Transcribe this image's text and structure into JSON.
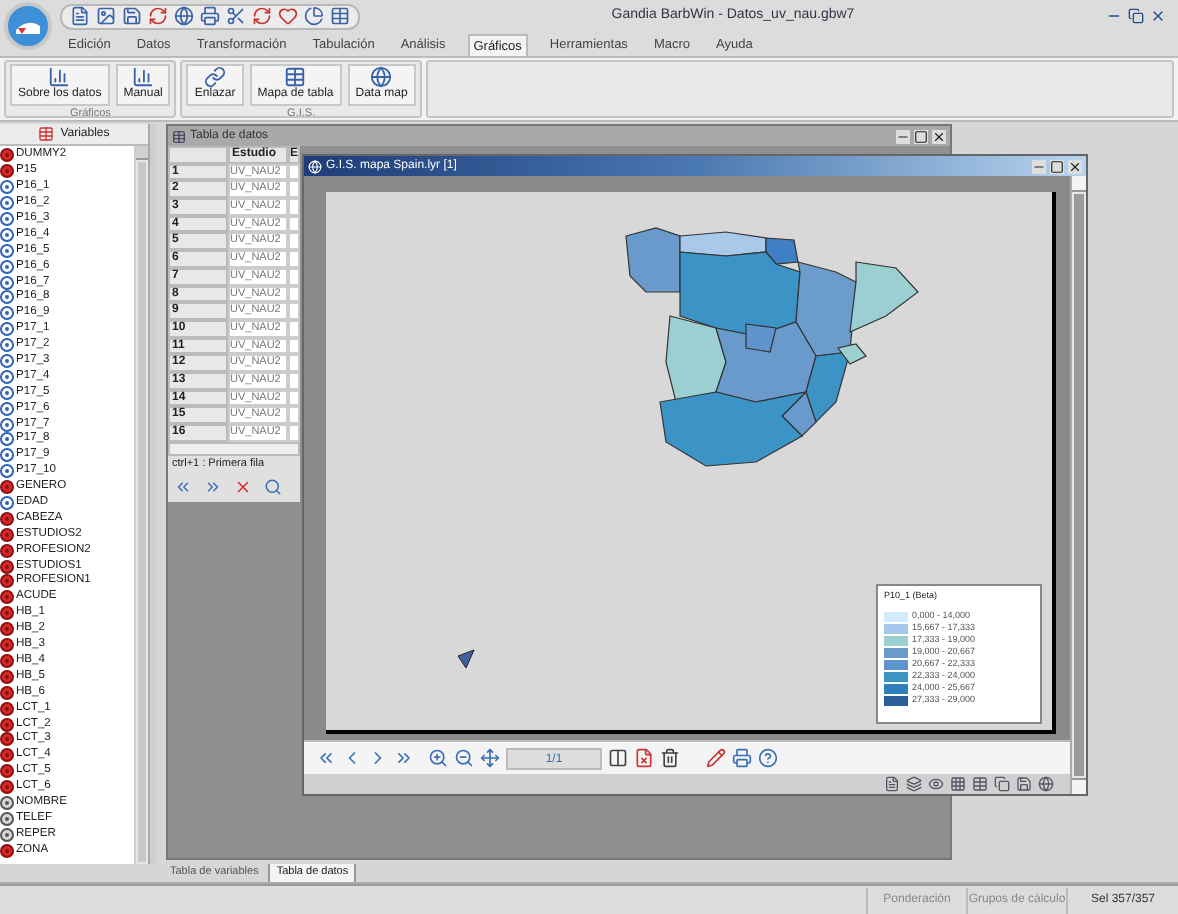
{
  "window": {
    "title": "Gandia BarbWin - Datos_uv_nau.gbw7"
  },
  "menu": [
    {
      "label": "Edición",
      "selected": false
    },
    {
      "label": "Datos",
      "selected": false
    },
    {
      "label": "Transformación",
      "selected": false
    },
    {
      "label": "Tabulación",
      "selected": false
    },
    {
      "label": "Análisis",
      "selected": false
    },
    {
      "label": "Gráficos",
      "selected": true
    },
    {
      "label": "Herramientas",
      "selected": false
    },
    {
      "label": "Macro",
      "selected": false
    },
    {
      "label": "Ayuda",
      "selected": false
    }
  ],
  "ribbon": {
    "groups": [
      {
        "label": "Gráficos",
        "buttons": [
          {
            "label": "Sobre los datos",
            "kind": "chart"
          },
          {
            "label": "Manual",
            "kind": "chart"
          }
        ]
      },
      {
        "label": "G.I.S.",
        "buttons": [
          {
            "label": "Enlazar",
            "kind": "link"
          },
          {
            "label": "Mapa de tabla",
            "kind": "table"
          },
          {
            "label": "Data map",
            "kind": "globe"
          }
        ]
      }
    ]
  },
  "variables_panel": {
    "title": "Variables",
    "items": [
      {
        "name": "DUMMY2",
        "kind": "nominal"
      },
      {
        "name": "P15",
        "kind": "nominal"
      },
      {
        "name": "P16_1",
        "kind": "scale"
      },
      {
        "name": "P16_2",
        "kind": "scale"
      },
      {
        "name": "P16_3",
        "kind": "scale"
      },
      {
        "name": "P16_4",
        "kind": "scale"
      },
      {
        "name": "P16_5",
        "kind": "scale"
      },
      {
        "name": "P16_6",
        "kind": "scale"
      },
      {
        "name": "P16_7",
        "kind": "scale"
      },
      {
        "name": "P16_8",
        "kind": "scale"
      },
      {
        "name": "P16_9",
        "kind": "scale"
      },
      {
        "name": "P17_1",
        "kind": "scale"
      },
      {
        "name": "P17_2",
        "kind": "scale"
      },
      {
        "name": "P17_3",
        "kind": "scale"
      },
      {
        "name": "P17_4",
        "kind": "scale"
      },
      {
        "name": "P17_5",
        "kind": "scale"
      },
      {
        "name": "P17_6",
        "kind": "scale"
      },
      {
        "name": "P17_7",
        "kind": "scale"
      },
      {
        "name": "P17_8",
        "kind": "scale"
      },
      {
        "name": "P17_9",
        "kind": "scale"
      },
      {
        "name": "P17_10",
        "kind": "scale"
      },
      {
        "name": "GENERO",
        "kind": "nominal"
      },
      {
        "name": "EDAD",
        "kind": "scale"
      },
      {
        "name": "CABEZA",
        "kind": "nominal"
      },
      {
        "name": "ESTUDIOS2",
        "kind": "nominal"
      },
      {
        "name": "PROFESION2",
        "kind": "nominal"
      },
      {
        "name": "ESTUDIOS1",
        "kind": "nominal"
      },
      {
        "name": "PROFESION1",
        "kind": "nominal"
      },
      {
        "name": "ACUDE",
        "kind": "nominal"
      },
      {
        "name": "HB_1",
        "kind": "nominal"
      },
      {
        "name": "HB_2",
        "kind": "nominal"
      },
      {
        "name": "HB_3",
        "kind": "nominal"
      },
      {
        "name": "HB_4",
        "kind": "nominal"
      },
      {
        "name": "HB_5",
        "kind": "nominal"
      },
      {
        "name": "HB_6",
        "kind": "nominal"
      },
      {
        "name": "LCT_1",
        "kind": "nominal"
      },
      {
        "name": "LCT_2",
        "kind": "nominal"
      },
      {
        "name": "LCT_3",
        "kind": "nominal"
      },
      {
        "name": "LCT_4",
        "kind": "nominal"
      },
      {
        "name": "LCT_5",
        "kind": "nominal"
      },
      {
        "name": "LCT_6",
        "kind": "nominal"
      },
      {
        "name": "NOMBRE",
        "kind": "string"
      },
      {
        "name": "TELEF",
        "kind": "string"
      },
      {
        "name": "REPER",
        "kind": "string"
      },
      {
        "name": "ZONA",
        "kind": "nominal"
      }
    ]
  },
  "data_window": {
    "title": "Tabla de datos",
    "columns": [
      "Estudio",
      "E"
    ],
    "rows": [
      {
        "number": "1",
        "cells": [
          "UV_NAU2"
        ]
      },
      {
        "number": "2",
        "cells": [
          "UV_NAU2"
        ]
      },
      {
        "number": "3",
        "cells": [
          "UV_NAU2"
        ]
      },
      {
        "number": "4",
        "cells": [
          "UV_NAU2"
        ]
      },
      {
        "number": "5",
        "cells": [
          "UV_NAU2"
        ]
      },
      {
        "number": "6",
        "cells": [
          "UV_NAU2"
        ]
      },
      {
        "number": "7",
        "cells": [
          "UV_NAU2"
        ]
      },
      {
        "number": "8",
        "cells": [
          "UV_NAU2"
        ]
      },
      {
        "number": "9",
        "cells": [
          "UV_NAU2"
        ]
      },
      {
        "number": "10",
        "cells": [
          "UV_NAU2"
        ]
      },
      {
        "number": "11",
        "cells": [
          "UV_NAU2"
        ]
      },
      {
        "number": "12",
        "cells": [
          "UV_NAU2"
        ]
      },
      {
        "number": "13",
        "cells": [
          "UV_NAU2"
        ]
      },
      {
        "number": "14",
        "cells": [
          "UV_NAU2"
        ]
      },
      {
        "number": "15",
        "cells": [
          "UV_NAU2"
        ]
      },
      {
        "number": "16",
        "cells": [
          "UV_NAU2"
        ]
      }
    ],
    "hint": "ctrl+1 : Primera fila"
  },
  "map_window": {
    "title": "G.I.S. mapa Spain.lyr [1]",
    "page": "1/1",
    "legend": {
      "title": "P10_1 (Beta)",
      "items": [
        {
          "label": "0,000 - 14,000",
          "color": "#d4ebfb"
        },
        {
          "label": "15,667 - 17,333",
          "color": "#a6c8ec"
        },
        {
          "label": "17,333 - 19,000",
          "color": "#9ccfd1"
        },
        {
          "label": "19,000 - 20,667",
          "color": "#6a9acb"
        },
        {
          "label": "20,667 - 22,333",
          "color": "#5f95cc"
        },
        {
          "label": "22,333 - 24,000",
          "color": "#3c93c6"
        },
        {
          "label": "24,000 - 25,667",
          "color": "#2f7fb8"
        },
        {
          "label": "27,333 - 29,000",
          "color": "#2c5f98"
        }
      ]
    }
  },
  "sheet_tabs": [
    {
      "label": "Tabla de variables",
      "selected": false
    },
    {
      "label": "Tabla de datos",
      "selected": true
    }
  ],
  "status_bar": [
    "Ponderación",
    "Grupos de cálculo",
    "Sel 357/357"
  ]
}
